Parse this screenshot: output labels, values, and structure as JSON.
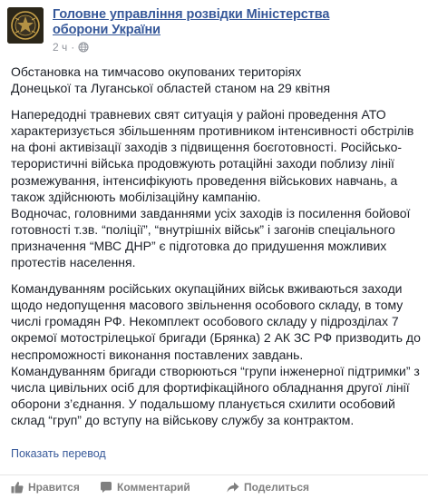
{
  "post": {
    "page_name": "Головне управління розвідки Міністерства оборони України",
    "time": "2 ч",
    "dot": "·",
    "paragraphs": [
      "Обстановка на тимчасово окупованих територіях\nДонецької та Луганської областей станом на 29 квітня",
      "Напередодні травневих свят ситуація у районі проведення АТО характеризується збільшенням противником інтенсивності обстрілів на фоні активізації заходів з підвищення боєготовності. Російсько-терористичні війська продовжують ротаційні заходи поблизу лінії розмежування, інтенсифікують проведення військових навчань, а також здійснюють мобілізаційну кампанію.\nВодночас, головними завданнями усіх заходів із посилення бойової готовності т.зв. “поліції”, “внутрішніх військ” і загонів спеціального призначення “МВС ДНР” є підготовка до придушення можливих протестів населення.",
      "Командуванням російських окупаційних військ вживаються заходи щодо недопущення масового звільнення особового складу, в тому числі громадян РФ. Некомплект особового складу у підрозділах 7 окремої мотострілецької бригади (Брянка) 2 АК ЗС РФ призводить до неспроможності виконання поставлених завдань.\nКомандуванням бригади створюються “групи інженерної підтримки” з числа цивільних осіб для фортифікаційного обладнання другої лінії оборони з’єднання. У подальшому планується схилити особовий склад “груп” до вступу на військову службу за контрактом."
    ],
    "translate_link": "Показать перевод"
  },
  "actions": {
    "like": "Нравится",
    "comment": "Комментарий",
    "share": "Поделиться"
  },
  "icons": {
    "avatar": "intelligence-emblem-icon",
    "privacy": "globe-icon",
    "like": "thumbs-up-icon",
    "comment": "comment-bubble-icon",
    "share": "share-arrow-icon"
  },
  "colors": {
    "link": "#365899",
    "meta": "#90949c",
    "text": "#1d2129",
    "action": "#7f7f7f"
  }
}
